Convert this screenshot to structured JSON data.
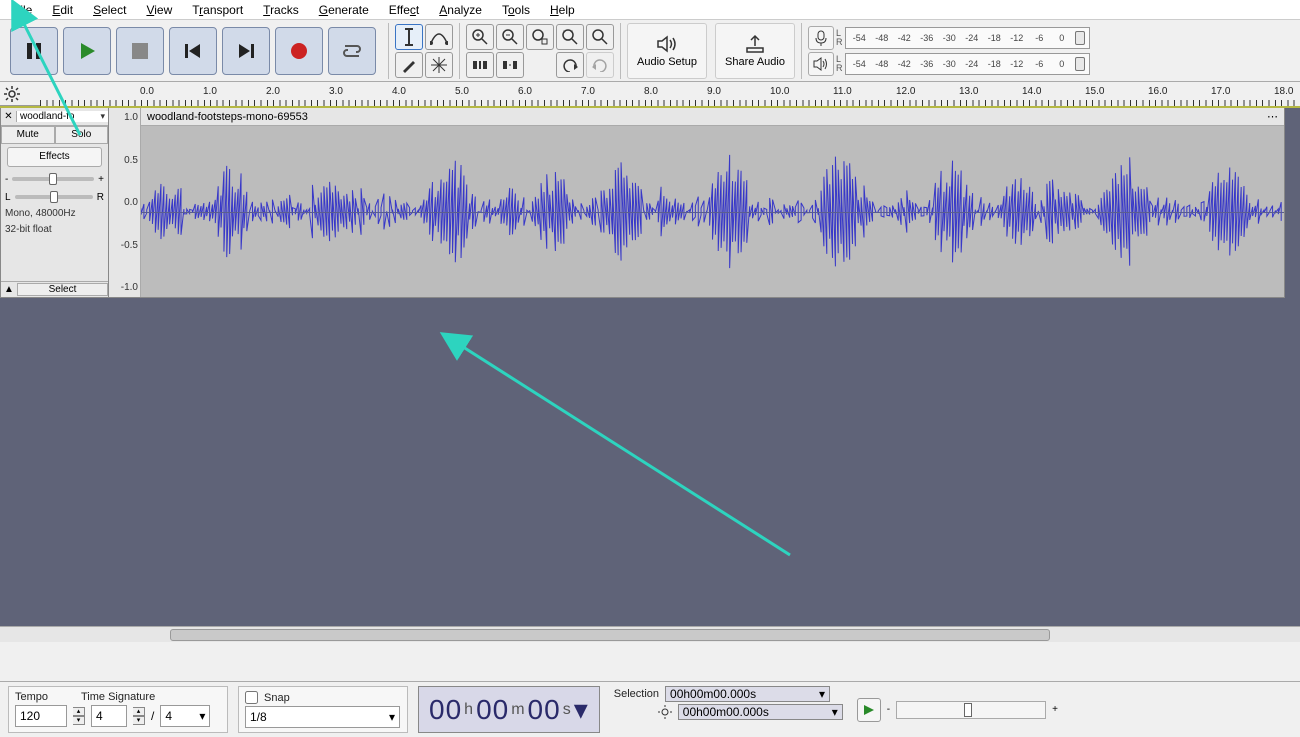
{
  "menu": [
    "File",
    "Edit",
    "Select",
    "View",
    "Transport",
    "Tracks",
    "Generate",
    "Effect",
    "Analyze",
    "Tools",
    "Help"
  ],
  "toolbar": {
    "audio_setup": "Audio Setup",
    "share_audio": "Share Audio"
  },
  "meter_ticks": [
    "-54",
    "-48",
    "-42",
    "-36",
    "-30",
    "-24",
    "-18",
    "-12",
    "-6",
    "0"
  ],
  "ruler_ticks": [
    "0.0",
    "1.0",
    "2.0",
    "3.0",
    "4.0",
    "5.0",
    "6.0",
    "7.0",
    "8.0",
    "9.0",
    "10.0",
    "11.0",
    "12.0",
    "13.0",
    "14.0",
    "15.0",
    "16.0",
    "17.0",
    "18.0"
  ],
  "track": {
    "name_short": "woodland-fo",
    "name_full": "woodland-footsteps-mono-69553",
    "mute": "Mute",
    "solo": "Solo",
    "effects": "Effects",
    "pan_l": "L",
    "pan_r": "R",
    "gain_minus": "-",
    "gain_plus": "+",
    "format_line1": "Mono, 48000Hz",
    "format_line2": "32-bit float",
    "select": "Select",
    "amp_ticks": [
      "1.0",
      "0.5",
      "0.0",
      "-0.5",
      "-1.0"
    ]
  },
  "status": {
    "tempo_label": "Tempo",
    "timesig_label": "Time Signature",
    "tempo_value": "120",
    "ts_num": "4",
    "ts_den": "4",
    "snap_label": "Snap",
    "snap_value": "1/8",
    "time_h": "00",
    "time_m": "00",
    "time_s": "00",
    "selection_label": "Selection",
    "sel_start": "00h00m00.000s",
    "sel_end": "00h00m00.000s"
  }
}
